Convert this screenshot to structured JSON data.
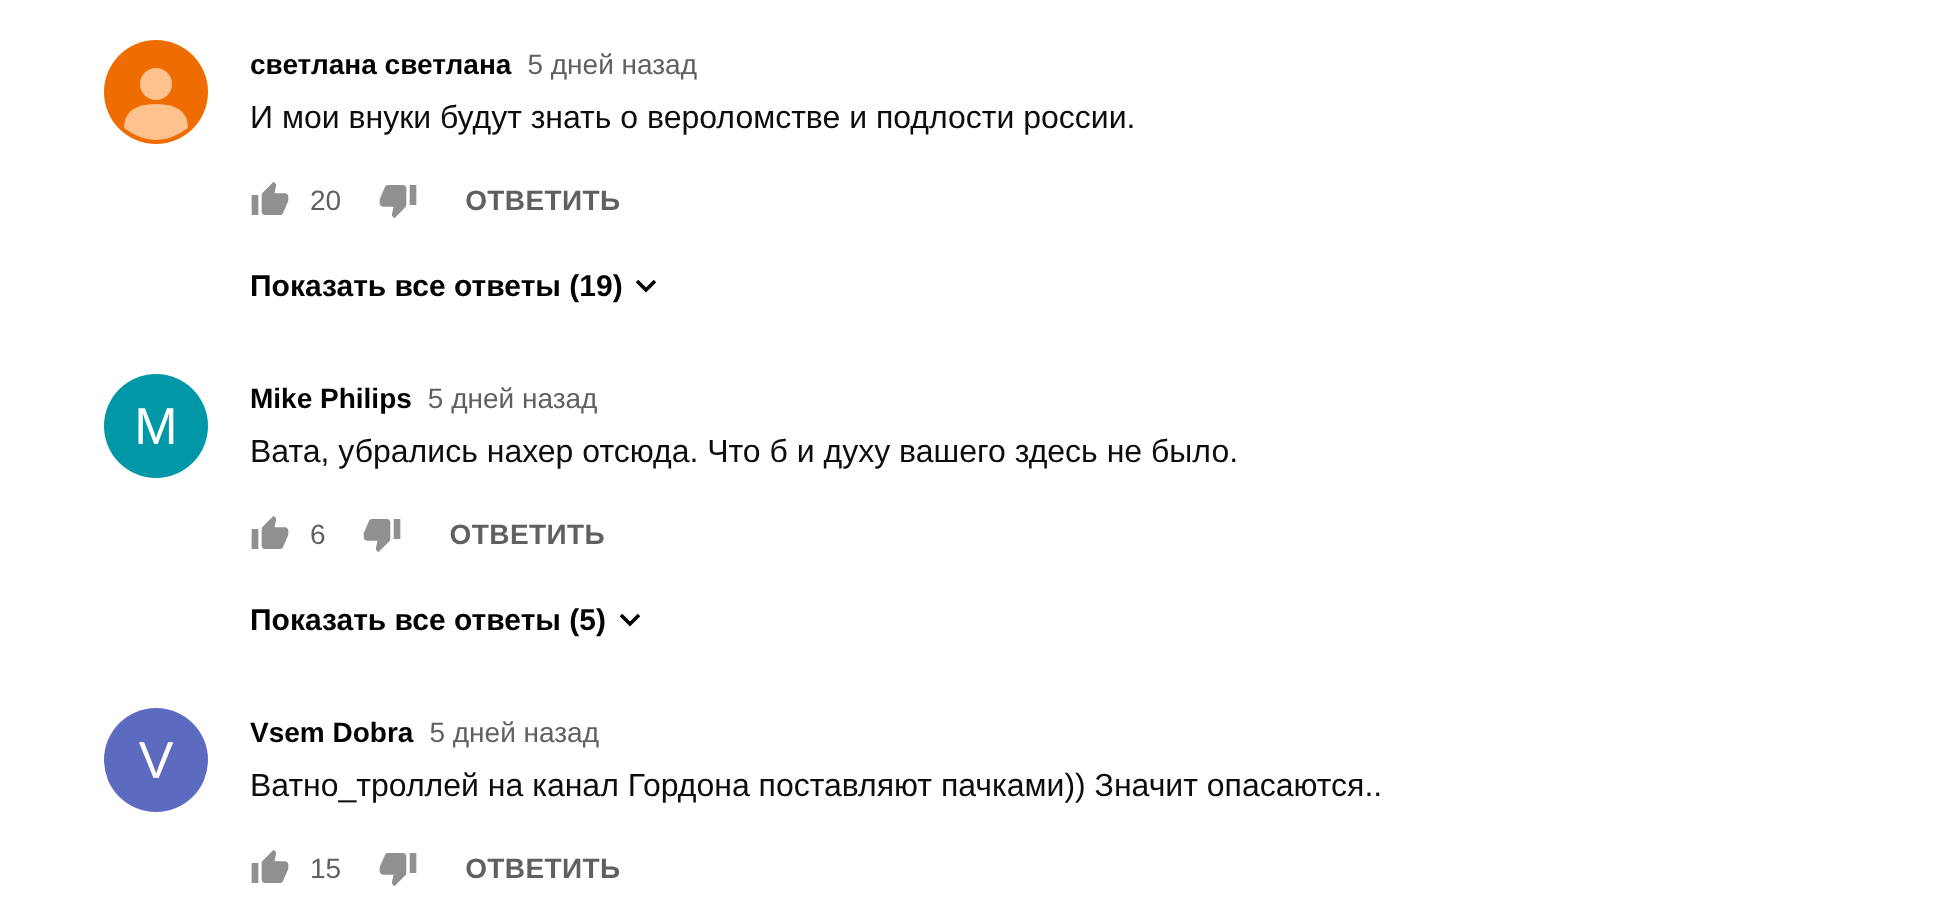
{
  "comments": [
    {
      "author": "светлана светлана",
      "time": "5 дней назад",
      "avatar": {
        "kind": "silhouette",
        "color": "#ef6c00"
      },
      "text": "И мои внуки будут знать о вероломстве и подлости россии.",
      "likes": "20",
      "reply": "ОТВЕТИТЬ",
      "show_replies": "Показать все ответы (19)"
    },
    {
      "author": "Mike Philips",
      "time": "5 дней назад",
      "avatar": {
        "kind": "letter",
        "letter": "M",
        "color": "#0097a7"
      },
      "text": "Вата, убрались нахер отсюда. Что б и духу вашего здесь не было.",
      "likes": "6",
      "reply": "ОТВЕТИТЬ",
      "show_replies": "Показать все ответы (5)"
    },
    {
      "author": "Vsem Dobra",
      "time": "5 дней назад",
      "avatar": {
        "kind": "letter",
        "letter": "V",
        "color": "#5c6bc0"
      },
      "text": "Ватно_троллей на канал Гордона поставляют пачками)) Значит опасаются..",
      "likes": "15",
      "reply": "ОТВЕТИТЬ"
    }
  ]
}
